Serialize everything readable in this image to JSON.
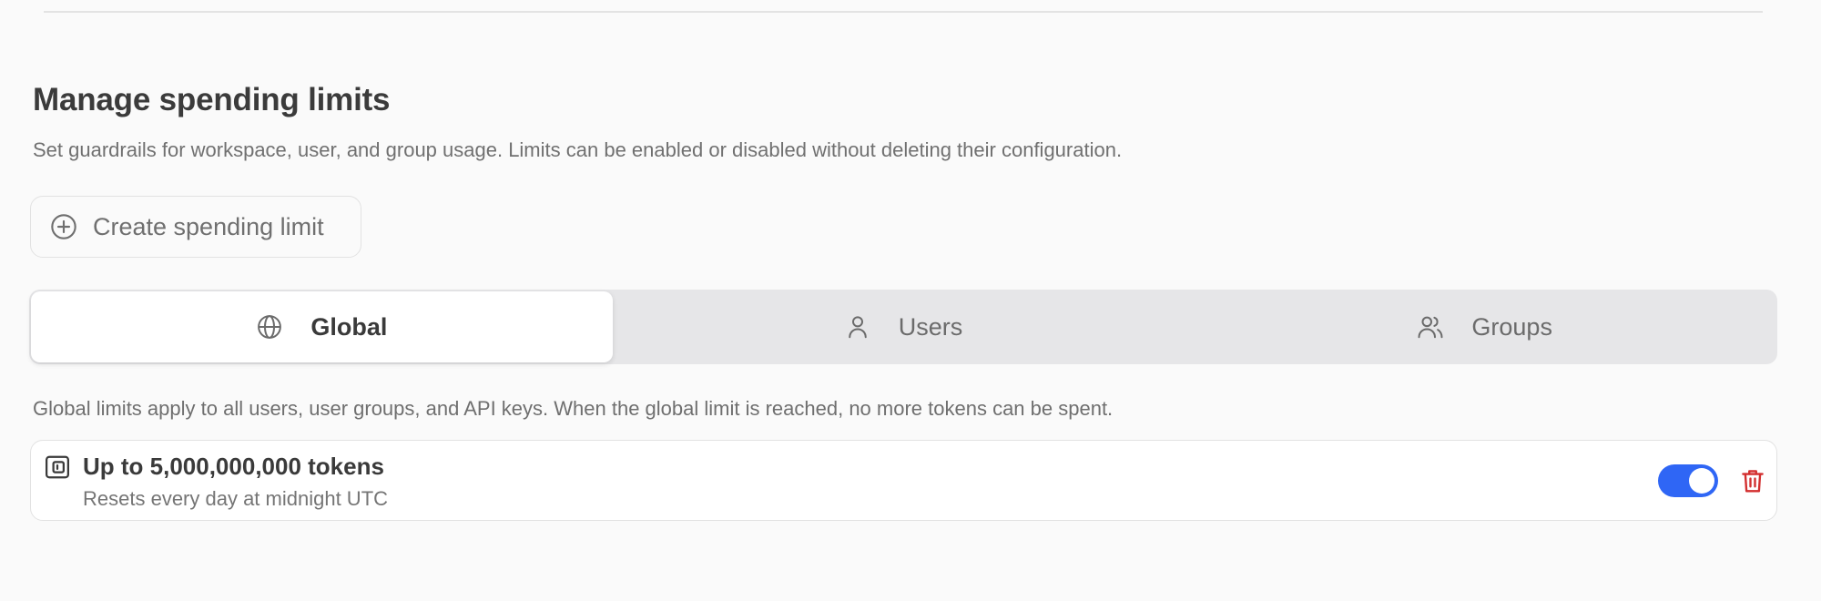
{
  "section": {
    "title": "Manage spending limits",
    "description": "Set guardrails for workspace, user, and group usage. Limits can be enabled or disabled without deleting their configuration."
  },
  "create_button": {
    "label": "Create spending limit",
    "icon": "plus-circle-icon"
  },
  "tabs": [
    {
      "label": "Global",
      "icon": "globe-icon",
      "active": true
    },
    {
      "label": "Users",
      "icon": "user-icon",
      "active": false
    },
    {
      "label": "Groups",
      "icon": "users-icon",
      "active": false
    }
  ],
  "tab_description": "Global limits apply to all users, user groups, and API keys. When the global limit is reached, no more tokens can be spent.",
  "limits": [
    {
      "icon": "wallet-icon",
      "title": "Up to 5,000,000,000 tokens",
      "subtitle": "Resets every day at midnight UTC",
      "enabled": true
    }
  ],
  "colors": {
    "accent": "#2f66f5",
    "danger": "#d32f2f"
  }
}
